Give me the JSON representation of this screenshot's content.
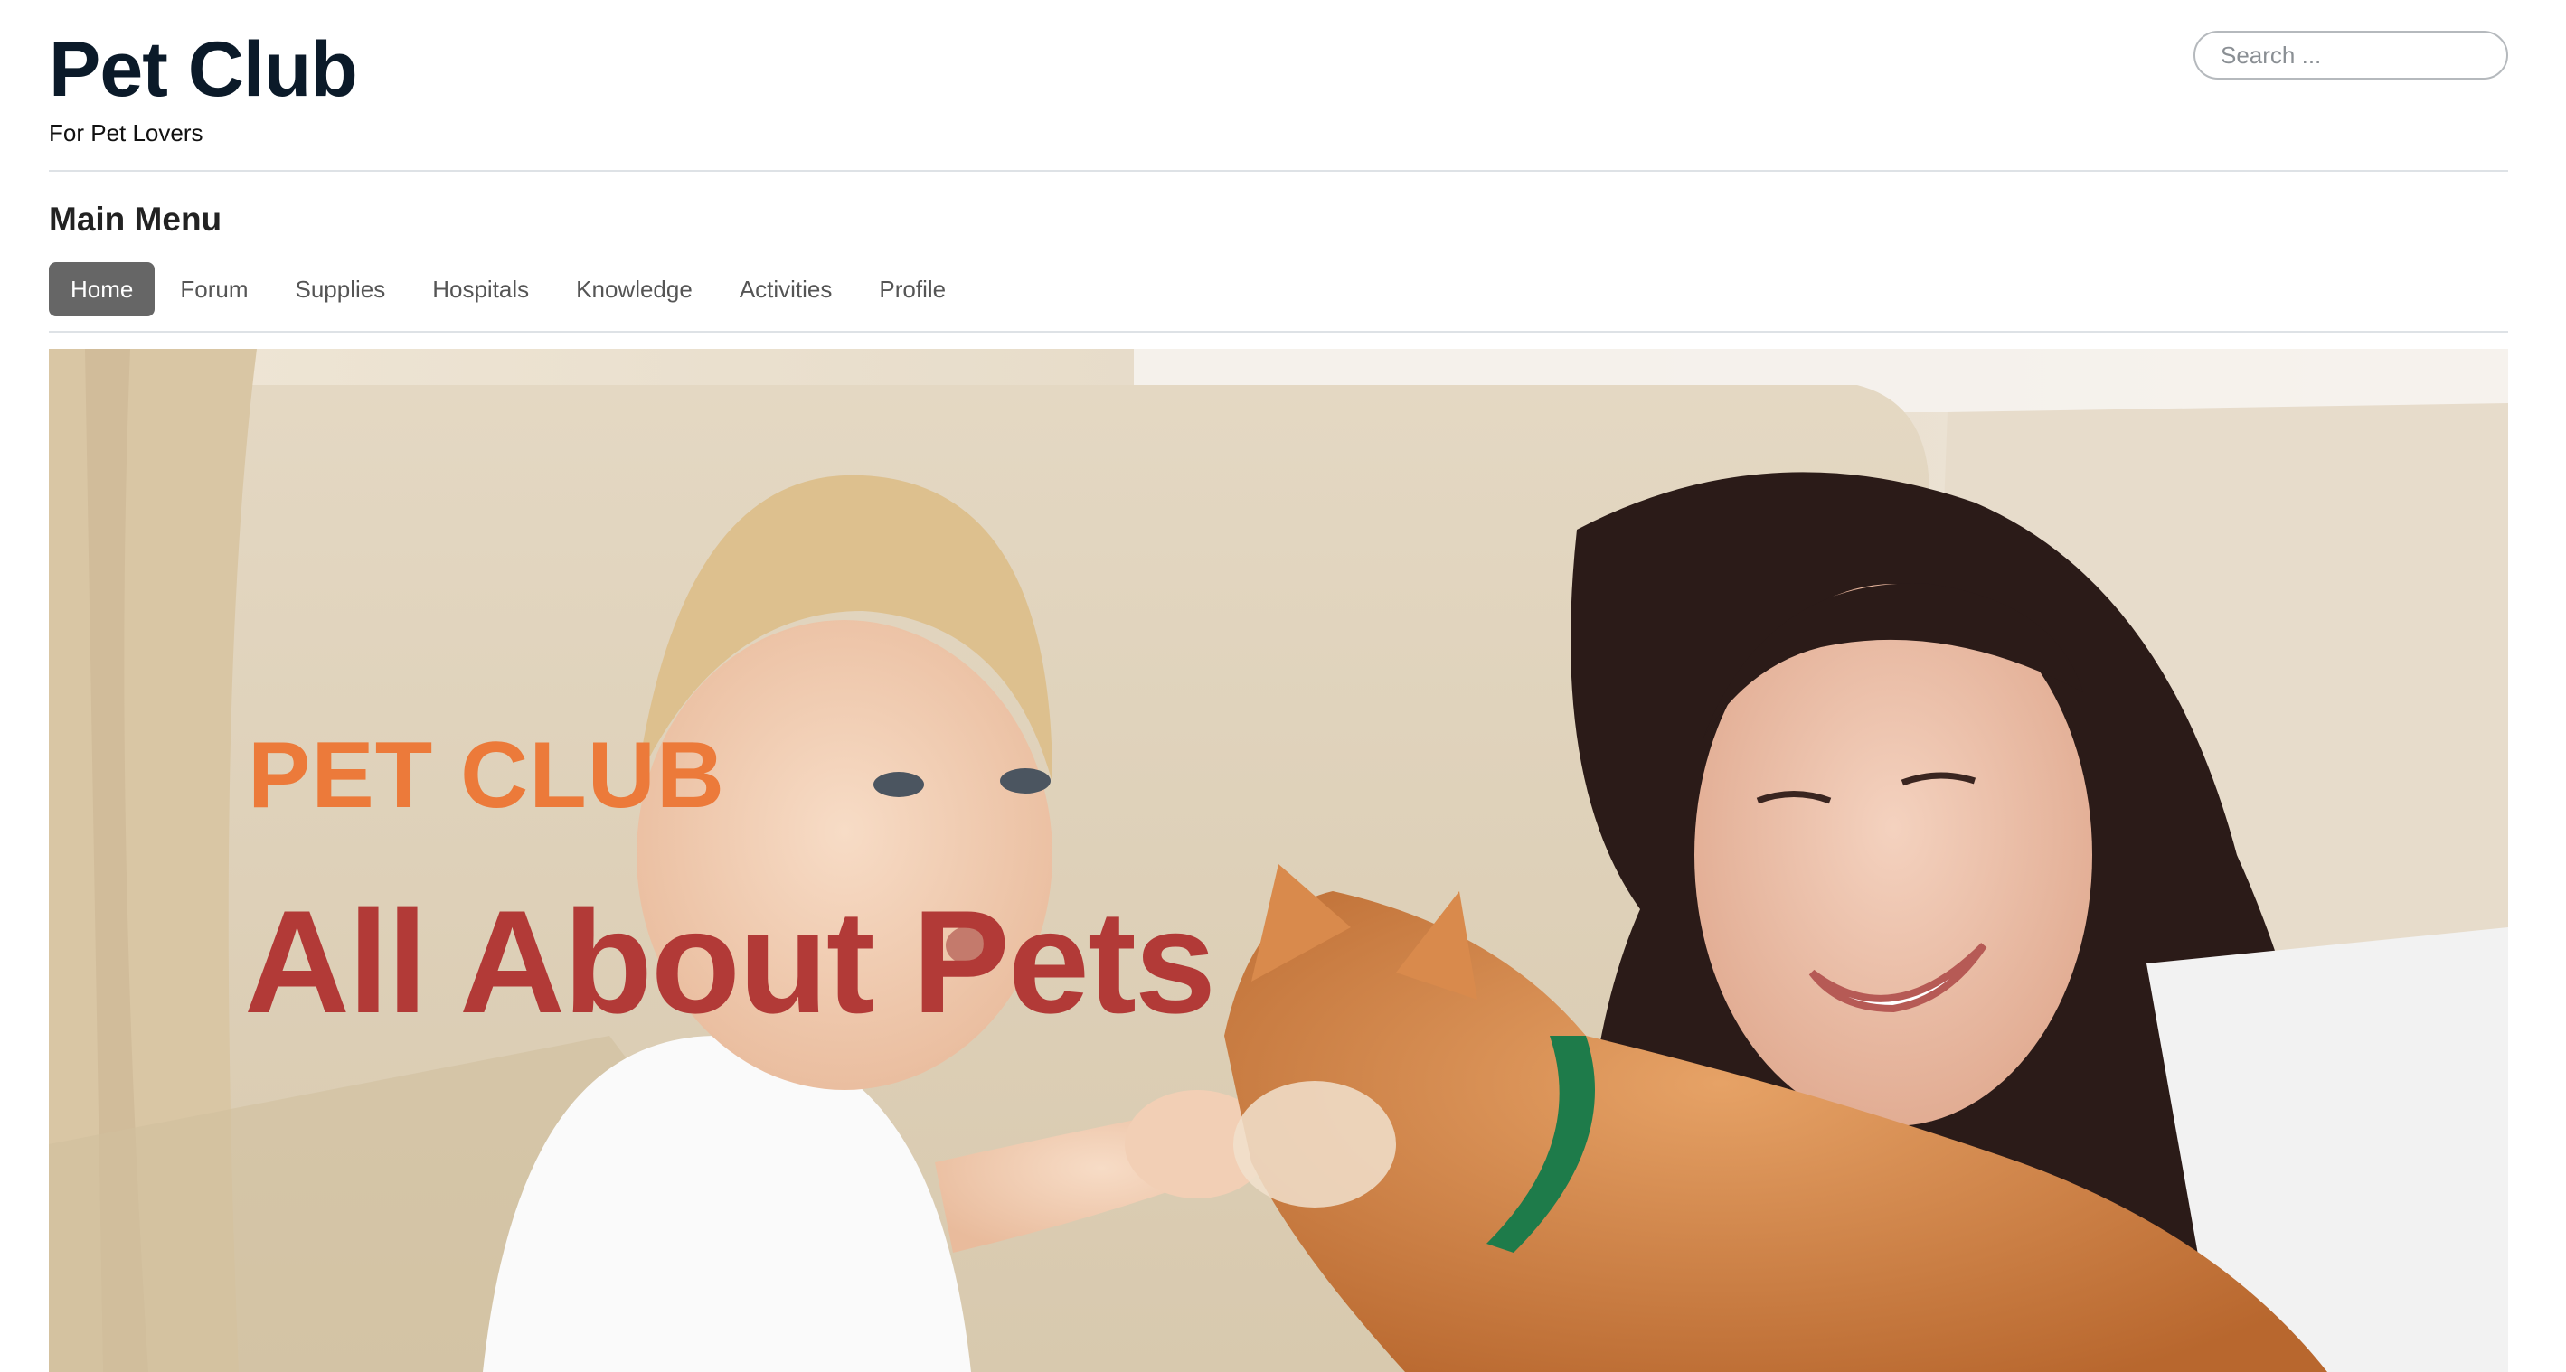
{
  "site": {
    "title": "Pet Club",
    "tagline": "For Pet Lovers"
  },
  "search": {
    "placeholder": "Search ..."
  },
  "menu": {
    "heading": "Main Menu",
    "items": [
      {
        "label": "Home",
        "active": true
      },
      {
        "label": "Forum",
        "active": false
      },
      {
        "label": "Supplies",
        "active": false
      },
      {
        "label": "Hospitals",
        "active": false
      },
      {
        "label": "Knowledge",
        "active": false
      },
      {
        "label": "Activities",
        "active": false
      },
      {
        "label": "Profile",
        "active": false
      }
    ]
  },
  "hero": {
    "kicker": "PET CLUB",
    "headline": "All About Pets"
  },
  "colors": {
    "brand_title": "#0b1a29",
    "nav_active_bg": "#666666",
    "hero_kicker": "#ec7a3a",
    "hero_headline": "#b23a37"
  }
}
